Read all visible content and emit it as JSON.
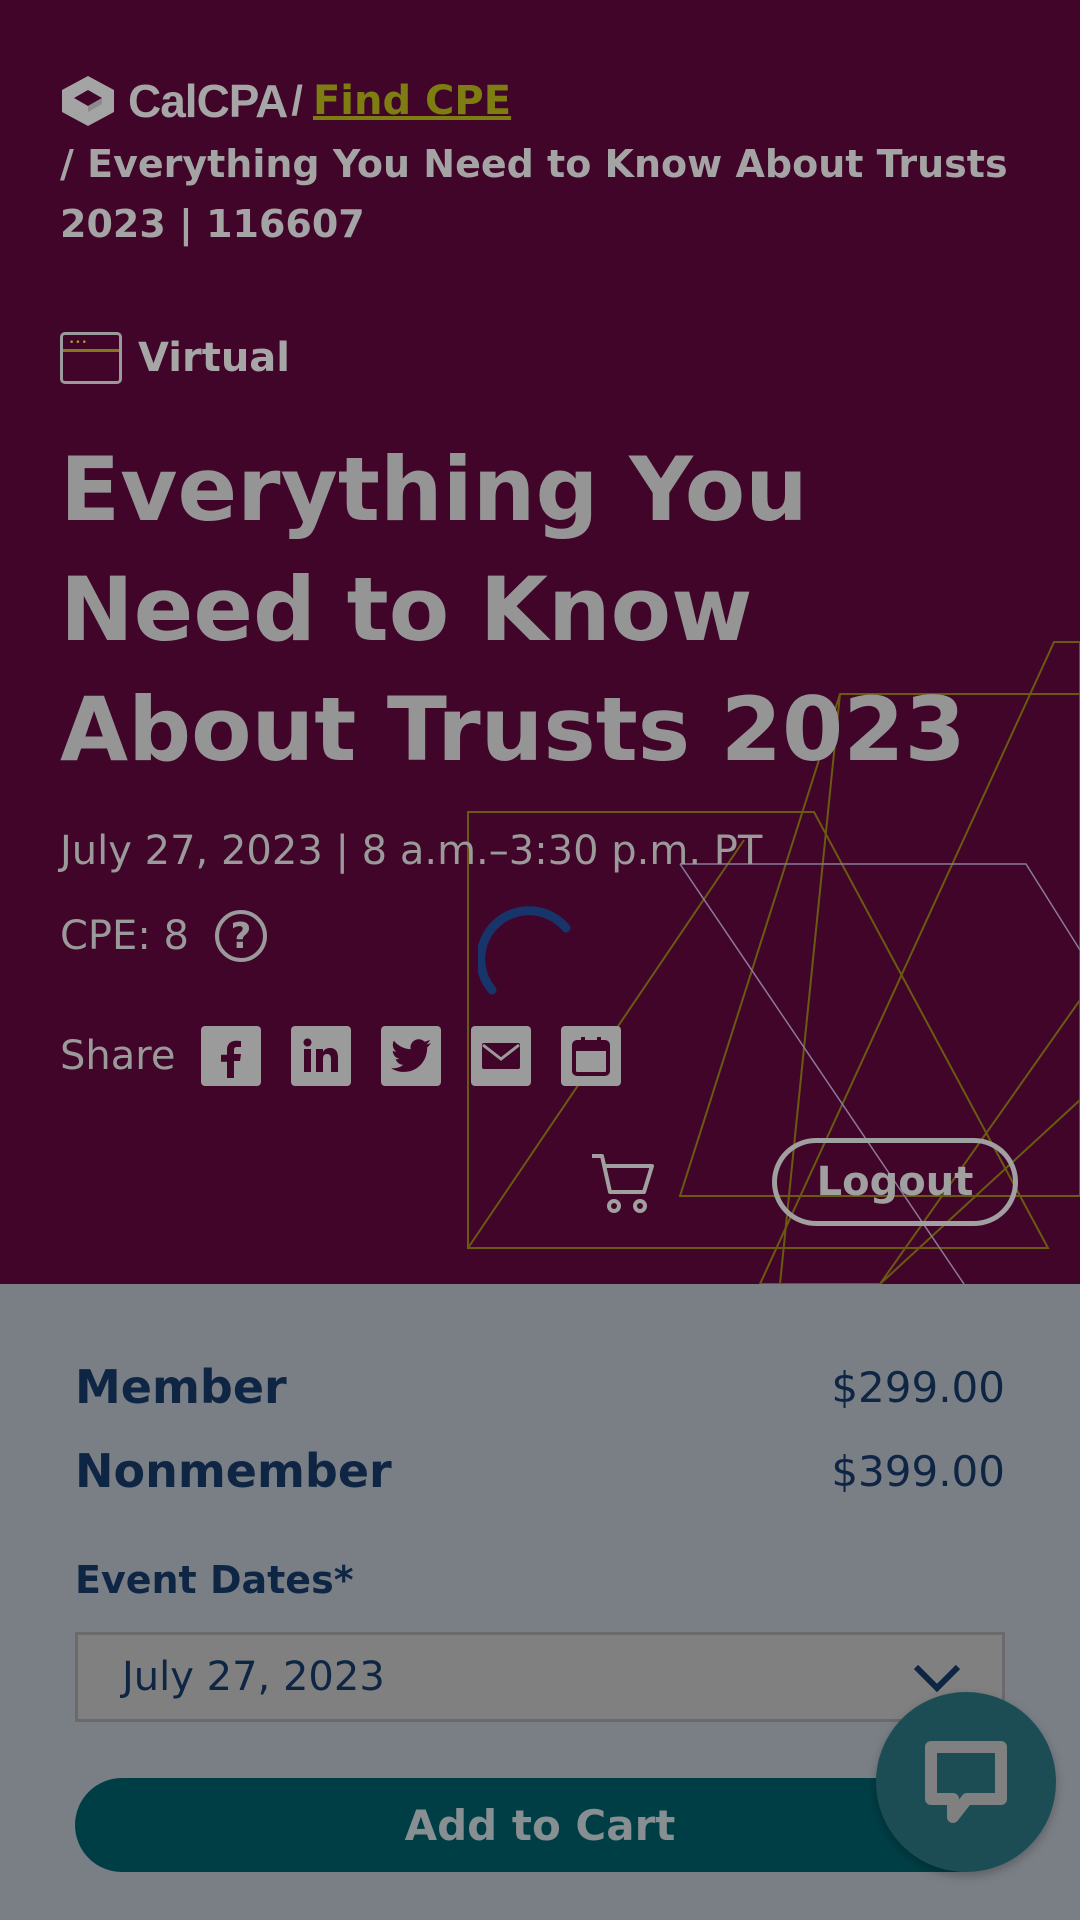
{
  "breadcrumb": {
    "logo_text": "CalCPA",
    "separator": "/",
    "link_label": "Find CPE",
    "current": "/ Everything You Need to Know About Trusts 2023 | 116607"
  },
  "event": {
    "format_label": "Virtual",
    "title": "Everything You Need to Know About Trusts 2023",
    "datetime": "July 27, 2023 | 8 a.m.–3:30 p.m. PT",
    "cpe_label": "CPE: 8",
    "help_glyph": "?"
  },
  "share": {
    "label": "Share",
    "buttons": [
      "facebook-icon",
      "linkedin-icon",
      "twitter-icon",
      "email-icon",
      "calendar-icon"
    ]
  },
  "header_actions": {
    "logout_label": "Logout"
  },
  "pricing": {
    "member_label": "Member",
    "member_price": "$299.00",
    "nonmember_label": "Nonmember",
    "nonmember_price": "$399.00"
  },
  "event_dates": {
    "label": "Event Dates*",
    "selected": "July 27, 2023"
  },
  "add_to_cart_label": "Add to Cart",
  "colors": {
    "hero_bg": "#41052a",
    "link": "#7d7d12",
    "navy_text": "#0e2544",
    "button_teal": "#003e45",
    "chat_bg": "#1c4d55"
  }
}
